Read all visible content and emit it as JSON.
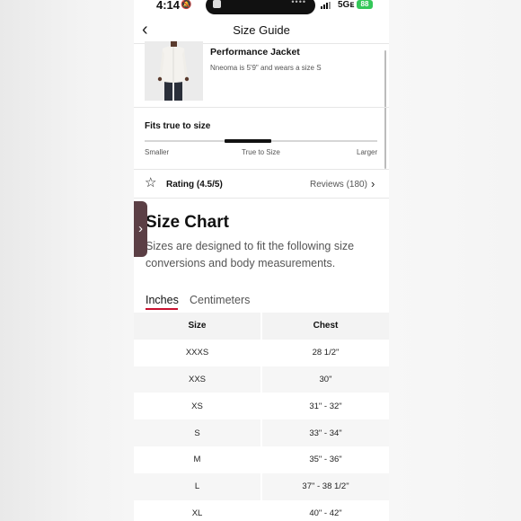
{
  "status_bar": {
    "time": "4:14",
    "network": "5Gᴇ",
    "battery": "88"
  },
  "header": {
    "back_icon": "chevron-left-icon",
    "title": "Size Guide"
  },
  "product": {
    "name": "Performance Jacket",
    "model_info": "Nneoma is 5'9\" and wears a size S"
  },
  "fit": {
    "title": "Fits true to size",
    "labels": {
      "smaller": "Smaller",
      "true_to_size": "True to Size",
      "larger": "Larger"
    },
    "level": 0.5
  },
  "rating": {
    "label": "Rating (4.5/5)",
    "reviews": "Reviews (180)"
  },
  "size_chart": {
    "heading": "Size Chart",
    "description": "Sizes are designed to fit the following size conversions and body measurements.",
    "tabs": [
      "Inches",
      "Centimeters"
    ],
    "active_tab": "Inches",
    "columns": [
      "Size",
      "Chest"
    ],
    "rows": [
      [
        "XXXS",
        "28 1/2\""
      ],
      [
        "XXS",
        "30\""
      ],
      [
        "XS",
        "31\" - 32\""
      ],
      [
        "S",
        "33\" - 34\""
      ],
      [
        "M",
        "35\" - 36\""
      ],
      [
        "L",
        "37\" - 38 1/2\""
      ],
      [
        "XL",
        "40\" - 42\""
      ]
    ]
  },
  "colors": {
    "accent_underline": "#c8102e",
    "side_tab": "#5b3f45"
  }
}
